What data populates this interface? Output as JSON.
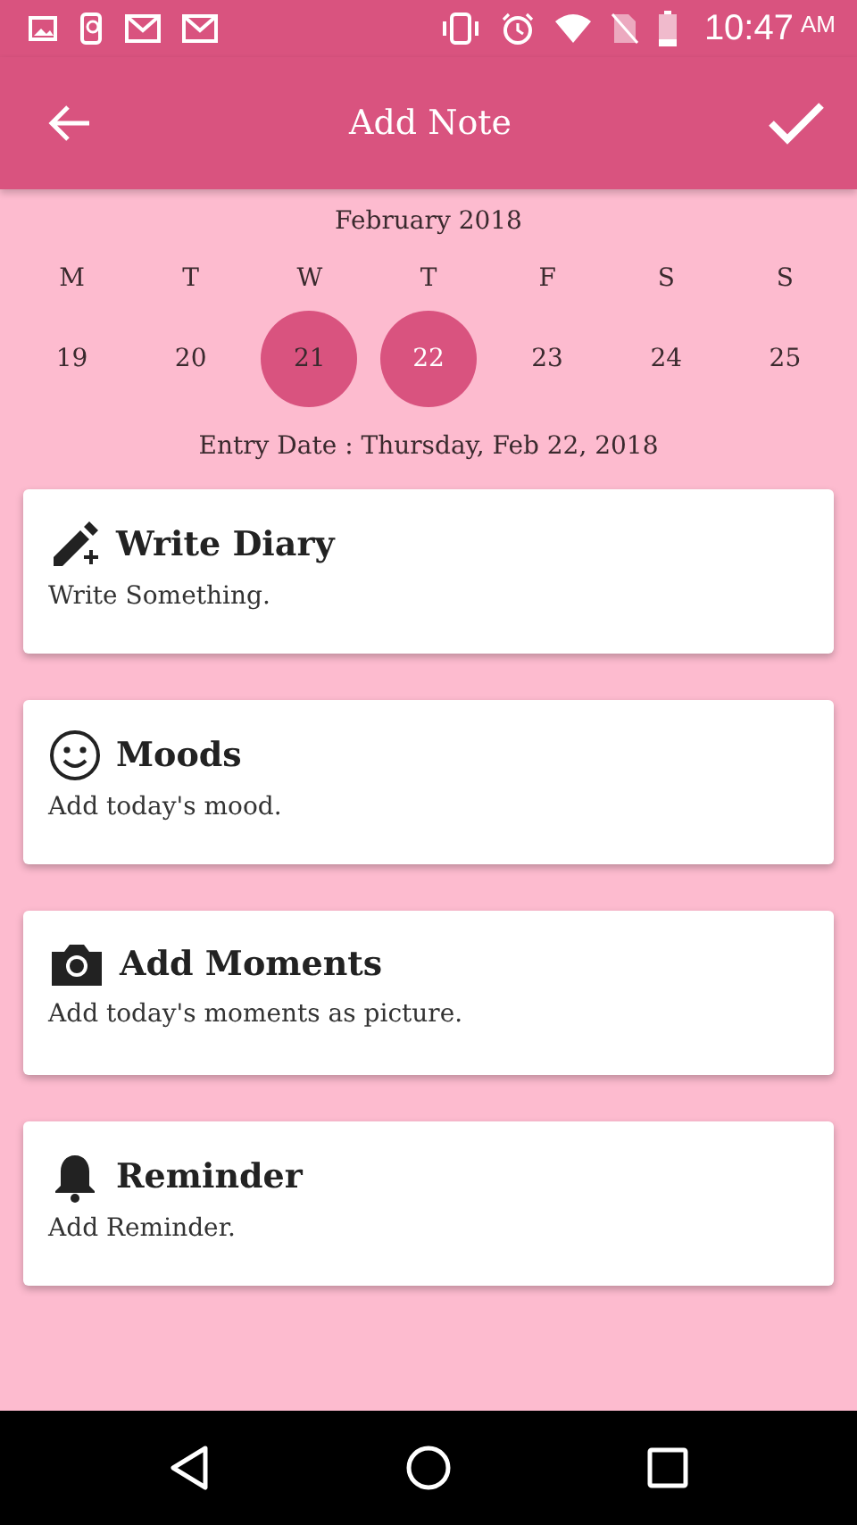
{
  "status_bar": {
    "time": "10:47",
    "ampm": "AM"
  },
  "app_bar": {
    "title": "Add Note"
  },
  "calendar": {
    "month": "February 2018",
    "weekdays": [
      "M",
      "T",
      "W",
      "T",
      "F",
      "S",
      "S"
    ],
    "days": [
      {
        "label": "19",
        "today": false,
        "selected": false
      },
      {
        "label": "20",
        "today": false,
        "selected": false
      },
      {
        "label": "21",
        "today": true,
        "selected": false
      },
      {
        "label": "22",
        "today": false,
        "selected": true
      },
      {
        "label": "23",
        "today": false,
        "selected": false
      },
      {
        "label": "24",
        "today": false,
        "selected": false
      },
      {
        "label": "25",
        "today": false,
        "selected": false
      }
    ],
    "entry_date": "Entry Date : Thursday, Feb 22, 2018"
  },
  "cards": [
    {
      "kind": "diary",
      "title": "Write Diary",
      "subtitle": "Write Something."
    },
    {
      "kind": "mood",
      "title": "Moods",
      "subtitle": "Add today's mood."
    },
    {
      "kind": "moments",
      "title": "Add Moments",
      "subtitle": "Add today's moments as picture."
    },
    {
      "kind": "reminder",
      "title": "Reminder",
      "subtitle": "Add Reminder."
    }
  ]
}
